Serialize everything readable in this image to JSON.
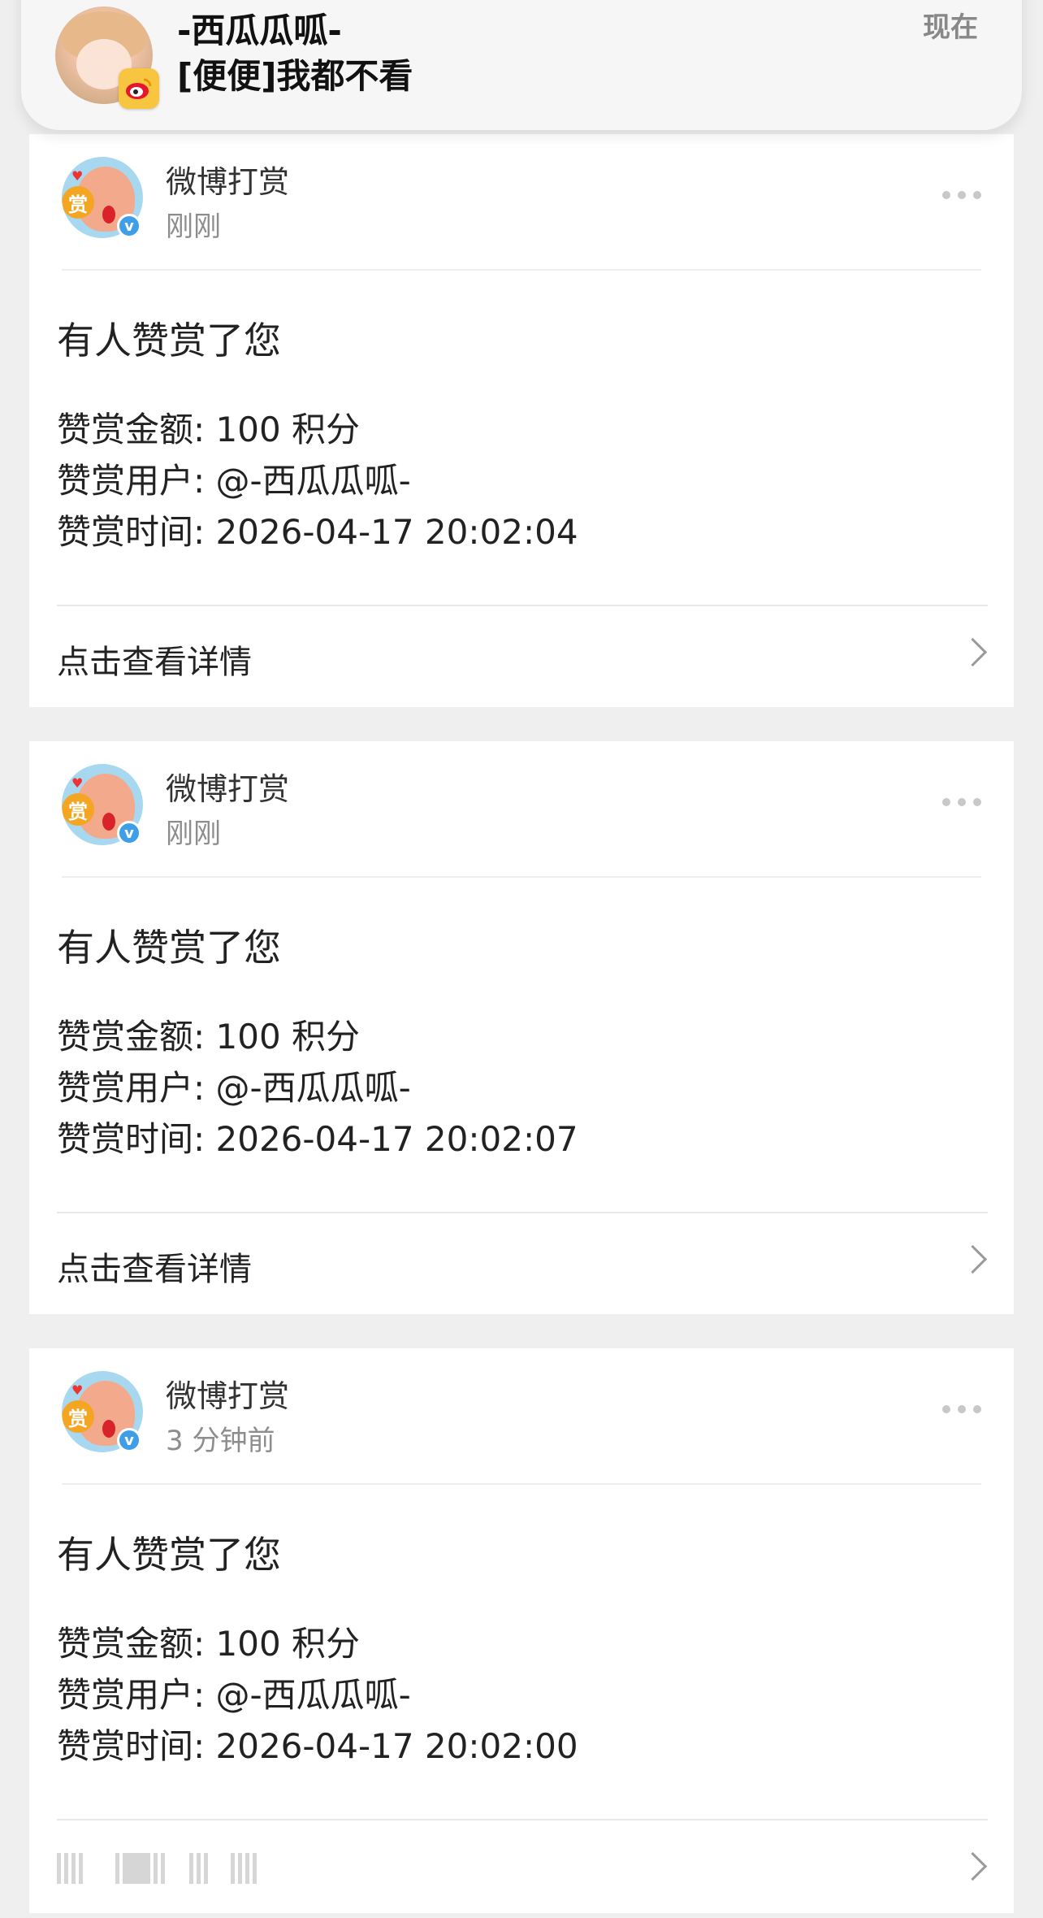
{
  "notification": {
    "sender": "-西瓜瓜呱-",
    "message": "[便便]我都不看",
    "time": "现在"
  },
  "cards": [
    {
      "sender": "微博打赏",
      "time": "刚刚",
      "title": "有人赞赏了您",
      "amount_line": "赞赏金额: 100 积分",
      "user_line": "赞赏用户: @-西瓜瓜呱-",
      "time_line": "赞赏时间: 2026-04-17 20:02:04",
      "footer": "点击查看详情"
    },
    {
      "sender": "微博打赏",
      "time": "刚刚",
      "title": "有人赞赏了您",
      "amount_line": "赞赏金额: 100 积分",
      "user_line": "赞赏用户: @-西瓜瓜呱-",
      "time_line": "赞赏时间: 2026-04-17 20:02:07",
      "footer": "点击查看详情"
    },
    {
      "sender": "微博打赏",
      "time": "3 分钟前",
      "title": "有人赞赏了您",
      "amount_line": "赞赏金额: 100 积分",
      "user_line": "赞赏用户: @-西瓜瓜呱-",
      "time_line": "赞赏时间: 2026-04-17 20:02:00",
      "footer": ""
    }
  ],
  "avatar_coin": "赏",
  "verified_mark": "v"
}
